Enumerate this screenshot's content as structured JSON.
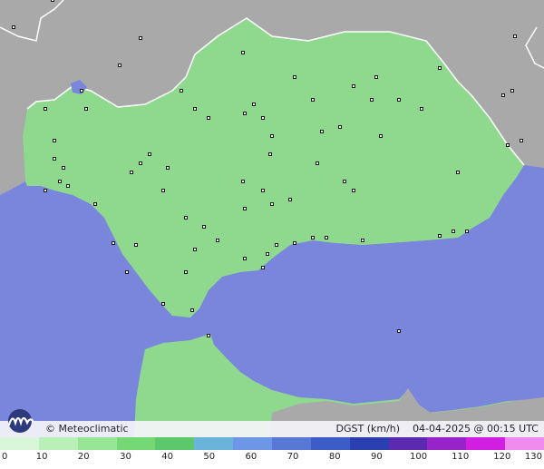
{
  "map": {
    "colors": {
      "sea": "#7a86dc",
      "foreign_land": "#a9a9a9",
      "region_land": "#8fd98f",
      "border": "#ffffff"
    }
  },
  "branding": {
    "credit": "© Meteoclimatic",
    "logo_icon": "meteoclimatic-logo-icon"
  },
  "variable": {
    "label": "DGST (km/h)",
    "datetime": "04-04-2025 @ 00:15 UTC"
  },
  "legend": {
    "ticks": [
      "0",
      "10",
      "20",
      "30",
      "40",
      "50",
      "60",
      "70",
      "80",
      "90",
      "100",
      "110",
      "120",
      "130"
    ],
    "colors": [
      "#d8f7d8",
      "#b8f0b8",
      "#96e696",
      "#74d874",
      "#5cc86c",
      "#6ab4dc",
      "#6e96e6",
      "#5878d6",
      "#3c5cc8",
      "#2a40b0",
      "#5a2ab0",
      "#9624c8",
      "#d21ee0",
      "#f08cf0"
    ]
  }
}
